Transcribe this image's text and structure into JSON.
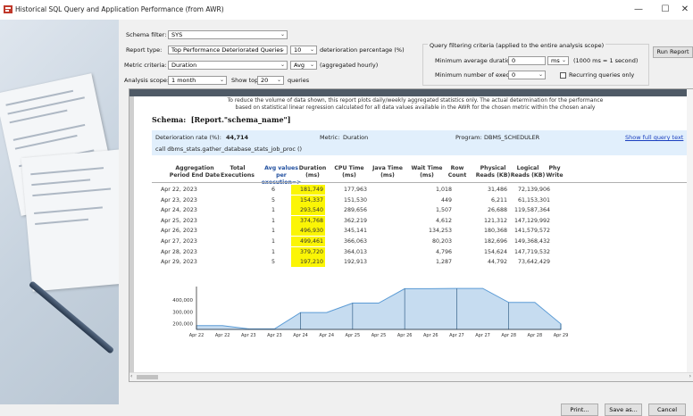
{
  "window": {
    "title": "Historical SQL Query and Application Performance (from AWR)",
    "minimize": "—",
    "maximize": "☐",
    "close": "✕"
  },
  "form": {
    "schema_filter_label": "Schema filter:",
    "schema_filter_value": "SYS",
    "report_type_label": "Report type:",
    "report_type_value": "Top Performance Deteriorated Queries",
    "deterioration_value": "10",
    "deterioration_label": "deterioration percentage (%)",
    "metric_label": "Metric criteria:",
    "metric_value": "Duration",
    "agg_value": "Avg",
    "agg_label": "(aggregated hourly)",
    "scope_label": "Analysis scope:",
    "scope_value": "1 month",
    "showtop_label": "Show top:",
    "showtop_value": "20",
    "queries_label": "queries",
    "criteria_legend": "Query filtering criteria (applied to the entire analysis scope)",
    "min_duration_label": "Minimum average duration:",
    "min_duration_value": "0",
    "ms_value": "ms",
    "ms_note": "(1000 ms = 1 second)",
    "min_exec_label": "Minimum number of executions:",
    "min_exec_value": "0",
    "recurring_label": "Recurring queries only",
    "run_report": "Run Report"
  },
  "report": {
    "note_line1": "To reduce the volume of data shown, this report plots daily/weekly aggregated statistics only. The actual determination for the performance",
    "note_line2": "based on statistical linear regression calculated for all data values available in the AWR for the chosen metric within the chosen analy",
    "schema_label": "Schema:",
    "schema_value": "[Report.\"schema_name\"]",
    "rate_label": "Deterioration rate (%):",
    "rate_value": "44,714",
    "metric_label": "Metric:",
    "metric_value": "Duration",
    "program_label": "Program:",
    "program_value": "DBMS_SCHEDULER",
    "show_full": "Show full query text",
    "query_text": "call dbms_stats.gather_database_stats_job_proc ()",
    "headers": [
      "Aggregation\nPeriod End Date",
      "Total\nExecutions",
      "Avg values per\nexecution=>",
      "Duration\n(ms)",
      "CPU Time\n(ms)",
      "Java Time\n(ms)",
      "Wait Time\n(ms)",
      "Row\nCount",
      "Physical\nReads (KB)",
      "Logical\nReads (KB)",
      "Phy\nWrite"
    ],
    "rows": [
      [
        "Apr 22, 2023",
        "6",
        "",
        "181,749",
        "177,963",
        "",
        "1,018",
        "",
        "31,486",
        "72,139,906"
      ],
      [
        "Apr 23, 2023",
        "5",
        "",
        "154,337",
        "151,530",
        "",
        "449",
        "",
        "6,211",
        "61,153,301"
      ],
      [
        "Apr 24, 2023",
        "1",
        "",
        "293,540",
        "289,656",
        "",
        "1,507",
        "",
        "26,688",
        "119,587,364"
      ],
      [
        "Apr 25, 2023",
        "1",
        "",
        "374,768",
        "362,219",
        "",
        "4,612",
        "",
        "121,312",
        "147,129,992"
      ],
      [
        "Apr 26, 2023",
        "1",
        "",
        "496,930",
        "345,141",
        "",
        "134,253",
        "",
        "180,368",
        "141,579,572"
      ],
      [
        "Apr 27, 2023",
        "1",
        "",
        "499,461",
        "366,063",
        "",
        "80,203",
        "",
        "182,696",
        "149,368,432"
      ],
      [
        "Apr 28, 2023",
        "1",
        "",
        "379,720",
        "364,013",
        "",
        "4,796",
        "",
        "154,624",
        "147,719,532"
      ],
      [
        "Apr 29, 2023",
        "5",
        "",
        "197,210",
        "192,913",
        "",
        "1,287",
        "",
        "44,792",
        "73,642,429"
      ]
    ]
  },
  "chart_data": {
    "type": "area",
    "x": [
      "Apr 22",
      "Apr 22",
      "Apr 23",
      "Apr 23",
      "Apr 24",
      "Apr 24",
      "Apr 25",
      "Apr 25",
      "Apr 26",
      "Apr 26",
      "Apr 27",
      "Apr 27",
      "Apr 28",
      "Apr 28",
      "Apr 29"
    ],
    "y": [
      181749,
      181749,
      154337,
      154337,
      293540,
      293540,
      374768,
      374768,
      496930,
      496930,
      499461,
      499461,
      379720,
      379720,
      197210
    ],
    "yticks": [
      "400,000",
      "300,000",
      "200,000"
    ],
    "ylim": [
      150000,
      500000
    ],
    "color": "#5b9bd5"
  },
  "footer": {
    "print": "Print...",
    "save": "Save as...",
    "cancel": "Cancel"
  }
}
